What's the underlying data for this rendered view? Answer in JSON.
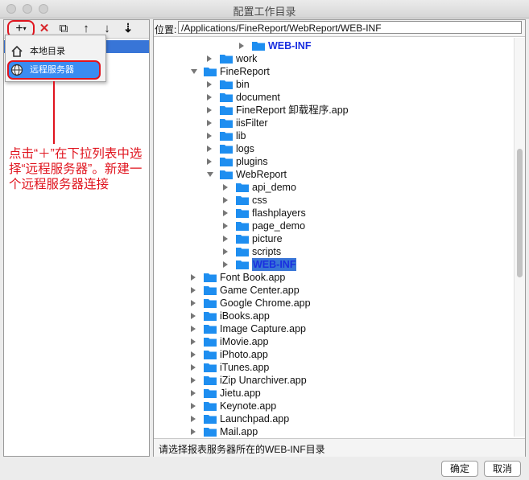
{
  "window": {
    "title": "配置工作目录"
  },
  "toolbar": {
    "add_label": "+",
    "delete_label": "✕",
    "copy_label": "⧉",
    "up_label": "↑",
    "down_label": "↓",
    "sort_label": "⇣"
  },
  "dropdown": {
    "local_label": "本地目录",
    "remote_label": "远程服务器"
  },
  "annotation": {
    "text": "点击“＋”在下拉列表中选择“远程服务器”。新建一个远程服务器连接"
  },
  "location": {
    "label": "位置:",
    "value": "/Applications/FineReport/WebReport/WEB-INF"
  },
  "tree": [
    {
      "label": "WEB-INF",
      "depth": 3,
      "state": "collapsed",
      "style": "bold-blue"
    },
    {
      "label": "work",
      "depth": 1,
      "state": "collapsed",
      "style": ""
    },
    {
      "label": "FineReport",
      "depth": 0,
      "state": "expanded",
      "style": ""
    },
    {
      "label": "bin",
      "depth": 1,
      "state": "collapsed",
      "style": ""
    },
    {
      "label": "document",
      "depth": 1,
      "state": "collapsed",
      "style": ""
    },
    {
      "label": "FineReport 卸载程序.app",
      "depth": 1,
      "state": "collapsed",
      "style": ""
    },
    {
      "label": "iisFilter",
      "depth": 1,
      "state": "collapsed",
      "style": ""
    },
    {
      "label": "lib",
      "depth": 1,
      "state": "collapsed",
      "style": ""
    },
    {
      "label": "logs",
      "depth": 1,
      "state": "collapsed",
      "style": ""
    },
    {
      "label": "plugins",
      "depth": 1,
      "state": "collapsed",
      "style": ""
    },
    {
      "label": "WebReport",
      "depth": 1,
      "state": "expanded",
      "style": ""
    },
    {
      "label": "api_demo",
      "depth": 2,
      "state": "collapsed",
      "style": ""
    },
    {
      "label": "css",
      "depth": 2,
      "state": "collapsed",
      "style": ""
    },
    {
      "label": "flashplayers",
      "depth": 2,
      "state": "collapsed",
      "style": ""
    },
    {
      "label": "page_demo",
      "depth": 2,
      "state": "collapsed",
      "style": ""
    },
    {
      "label": "picture",
      "depth": 2,
      "state": "collapsed",
      "style": ""
    },
    {
      "label": "scripts",
      "depth": 2,
      "state": "collapsed",
      "style": ""
    },
    {
      "label": "WEB-INF",
      "depth": 2,
      "state": "collapsed",
      "style": "highlight"
    },
    {
      "label": "Font Book.app",
      "depth": 0,
      "state": "collapsed",
      "style": ""
    },
    {
      "label": "Game Center.app",
      "depth": 0,
      "state": "collapsed",
      "style": ""
    },
    {
      "label": "Google Chrome.app",
      "depth": 0,
      "state": "collapsed",
      "style": ""
    },
    {
      "label": "iBooks.app",
      "depth": 0,
      "state": "collapsed",
      "style": ""
    },
    {
      "label": "Image Capture.app",
      "depth": 0,
      "state": "collapsed",
      "style": ""
    },
    {
      "label": "iMovie.app",
      "depth": 0,
      "state": "collapsed",
      "style": ""
    },
    {
      "label": "iPhoto.app",
      "depth": 0,
      "state": "collapsed",
      "style": ""
    },
    {
      "label": "iTunes.app",
      "depth": 0,
      "state": "collapsed",
      "style": ""
    },
    {
      "label": "iZip Unarchiver.app",
      "depth": 0,
      "state": "collapsed",
      "style": ""
    },
    {
      "label": "Jietu.app",
      "depth": 0,
      "state": "collapsed",
      "style": ""
    },
    {
      "label": "Keynote.app",
      "depth": 0,
      "state": "collapsed",
      "style": ""
    },
    {
      "label": "Launchpad.app",
      "depth": 0,
      "state": "collapsed",
      "style": ""
    },
    {
      "label": "Mail.app",
      "depth": 0,
      "state": "collapsed",
      "style": ""
    }
  ],
  "status": {
    "text": "请选择报表服务器所在的WEB-INF目录"
  },
  "buttons": {
    "ok": "确定",
    "cancel": "取消"
  },
  "colors": {
    "accent": "#3875d7",
    "annotation": "#e0141e",
    "folder": "#1e8ef0"
  }
}
